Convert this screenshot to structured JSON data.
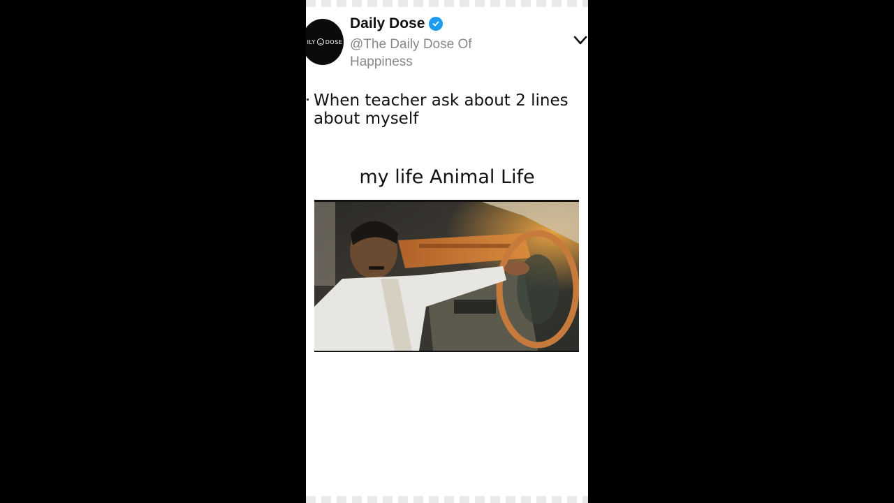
{
  "post": {
    "display_name": "Daily Dose",
    "handle": "@The Daily Dose Of Happiness",
    "avatar_text_left": "ILY",
    "avatar_text_right": "DOSE",
    "caption": "When teacher ask about 2 lines about myself",
    "subtitle": "my life Animal Life"
  },
  "icons": {
    "verified": "verified-badge-icon",
    "menu": "chevron-down-icon"
  },
  "colors": {
    "background": "#000000",
    "panel": "#ffffff",
    "verified": "#1d9bf0",
    "handle_text": "#888888"
  }
}
